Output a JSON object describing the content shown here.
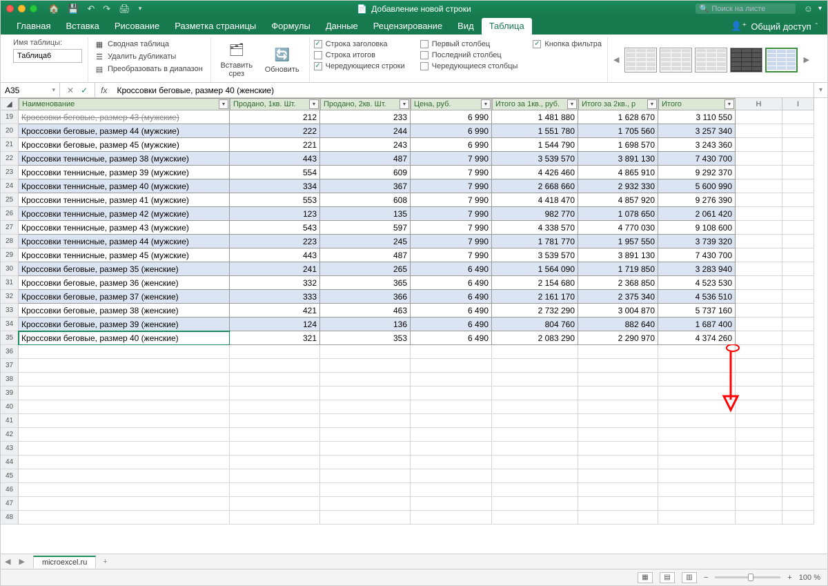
{
  "titlebar": {
    "title": "Добавление новой строки",
    "search_placeholder": "Поиск на листе"
  },
  "tabs": {
    "items": [
      "Главная",
      "Вставка",
      "Рисование",
      "Разметка страницы",
      "Формулы",
      "Данные",
      "Рецензирование",
      "Вид",
      "Таблица"
    ],
    "active_index": 8,
    "share": "Общий доступ"
  },
  "ribbon": {
    "table_name_label": "Имя таблицы:",
    "table_name_value": "Таблица6",
    "tools": {
      "pivot": "Сводная таблица",
      "dedup": "Удалить дубликаты",
      "convert": "Преобразовать в диапазон",
      "slicer": "Вставить срез",
      "refresh": "Обновить"
    },
    "options": {
      "header_row": {
        "label": "Строка заголовка",
        "checked": true
      },
      "total_row": {
        "label": "Строка итогов",
        "checked": false
      },
      "banded_rows": {
        "label": "Чередующиеся строки",
        "checked": true
      },
      "first_col": {
        "label": "Первый столбец",
        "checked": false
      },
      "last_col": {
        "label": "Последний столбец",
        "checked": false
      },
      "banded_cols": {
        "label": "Чередующиеся столбцы",
        "checked": false
      },
      "filter_btn": {
        "label": "Кнопка фильтра",
        "checked": true
      }
    }
  },
  "formula_bar": {
    "name_box": "A35",
    "formula": "Кроссовки беговые, размер 40 (женские)"
  },
  "columns": [
    {
      "label": "Наименование"
    },
    {
      "label": "Продано, 1кв. Шт."
    },
    {
      "label": "Продано, 2кв. Шт."
    },
    {
      "label": "Цена, руб."
    },
    {
      "label": "Итого за 1кв., руб."
    },
    {
      "label": "Итого за 2кв., р"
    },
    {
      "label": "Итого"
    }
  ],
  "col_headers_right": [
    "H",
    "I"
  ],
  "rows": [
    {
      "n": 19,
      "shade": false,
      "clip": true,
      "c": [
        "Кроссовки беговые, размер 43 (мужские)",
        "212",
        "233",
        "6 990",
        "1 481 880",
        "1 628 670",
        "3 110 550"
      ]
    },
    {
      "n": 20,
      "shade": true,
      "c": [
        "Кроссовки беговые, размер 44 (мужские)",
        "222",
        "244",
        "6 990",
        "1 551 780",
        "1 705 560",
        "3 257 340"
      ]
    },
    {
      "n": 21,
      "shade": false,
      "c": [
        "Кроссовки беговые, размер 45 (мужские)",
        "221",
        "243",
        "6 990",
        "1 544 790",
        "1 698 570",
        "3 243 360"
      ]
    },
    {
      "n": 22,
      "shade": true,
      "c": [
        "Кроссовки теннисные, размер 38 (мужские)",
        "443",
        "487",
        "7 990",
        "3 539 570",
        "3 891 130",
        "7 430 700"
      ]
    },
    {
      "n": 23,
      "shade": false,
      "c": [
        "Кроссовки теннисные, размер 39 (мужские)",
        "554",
        "609",
        "7 990",
        "4 426 460",
        "4 865 910",
        "9 292 370"
      ]
    },
    {
      "n": 24,
      "shade": true,
      "c": [
        "Кроссовки теннисные, размер 40 (мужские)",
        "334",
        "367",
        "7 990",
        "2 668 660",
        "2 932 330",
        "5 600 990"
      ]
    },
    {
      "n": 25,
      "shade": false,
      "c": [
        "Кроссовки теннисные, размер 41 (мужские)",
        "553",
        "608",
        "7 990",
        "4 418 470",
        "4 857 920",
        "9 276 390"
      ]
    },
    {
      "n": 26,
      "shade": true,
      "c": [
        "Кроссовки теннисные, размер 42 (мужские)",
        "123",
        "135",
        "7 990",
        "982 770",
        "1 078 650",
        "2 061 420"
      ]
    },
    {
      "n": 27,
      "shade": false,
      "c": [
        "Кроссовки теннисные, размер 43 (мужские)",
        "543",
        "597",
        "7 990",
        "4 338 570",
        "4 770 030",
        "9 108 600"
      ]
    },
    {
      "n": 28,
      "shade": true,
      "c": [
        "Кроссовки теннисные, размер 44 (мужские)",
        "223",
        "245",
        "7 990",
        "1 781 770",
        "1 957 550",
        "3 739 320"
      ]
    },
    {
      "n": 29,
      "shade": false,
      "c": [
        "Кроссовки теннисные, размер 45 (мужские)",
        "443",
        "487",
        "7 990",
        "3 539 570",
        "3 891 130",
        "7 430 700"
      ]
    },
    {
      "n": 30,
      "shade": true,
      "c": [
        "Кроссовки беговые, размер 35 (женские)",
        "241",
        "265",
        "6 490",
        "1 564 090",
        "1 719 850",
        "3 283 940"
      ]
    },
    {
      "n": 31,
      "shade": false,
      "c": [
        "Кроссовки беговые, размер 36 (женские)",
        "332",
        "365",
        "6 490",
        "2 154 680",
        "2 368 850",
        "4 523 530"
      ]
    },
    {
      "n": 32,
      "shade": true,
      "c": [
        "Кроссовки беговые, размер 37 (женские)",
        "333",
        "366",
        "6 490",
        "2 161 170",
        "2 375 340",
        "4 536 510"
      ]
    },
    {
      "n": 33,
      "shade": false,
      "c": [
        "Кроссовки беговые, размер 38 (женские)",
        "421",
        "463",
        "6 490",
        "2 732 290",
        "3 004 870",
        "5 737 160"
      ]
    },
    {
      "n": 34,
      "shade": true,
      "c": [
        "Кроссовки беговые, размер 39 (женские)",
        "124",
        "136",
        "6 490",
        "804 760",
        "882 640",
        "1 687 400"
      ]
    },
    {
      "n": 35,
      "shade": false,
      "active": true,
      "c": [
        "Кроссовки беговые, размер 40 (женские)",
        "321",
        "353",
        "6 490",
        "2 083 290",
        "2 290 970",
        "4 374 260"
      ]
    }
  ],
  "empty_rows": [
    36,
    37,
    38,
    39,
    40,
    41,
    42,
    43,
    44,
    45,
    46,
    47,
    48
  ],
  "sheet_tab": "microexcel.ru",
  "status": {
    "zoom": "100 %"
  }
}
